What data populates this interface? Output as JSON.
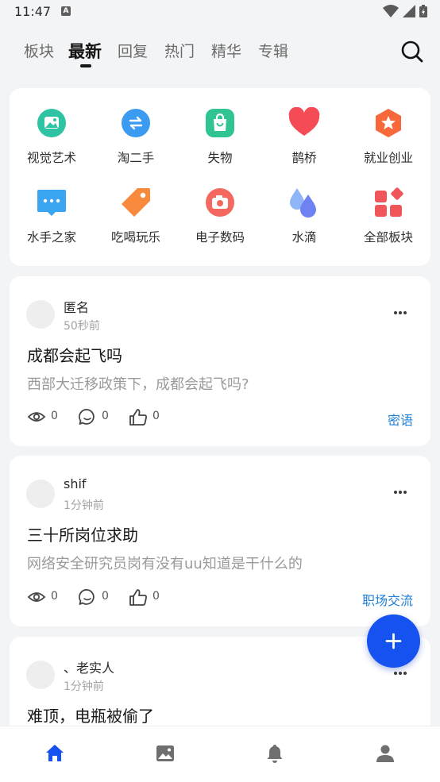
{
  "status_bar": {
    "time": "11:47",
    "indicator": "A"
  },
  "top_tabs": [
    {
      "label": "板块",
      "active": false
    },
    {
      "label": "最新",
      "active": true
    },
    {
      "label": "回复",
      "active": false
    },
    {
      "label": "热门",
      "active": false
    },
    {
      "label": "精华",
      "active": false
    },
    {
      "label": "专辑",
      "active": false
    }
  ],
  "categories": [
    {
      "label": "视觉艺术",
      "icon": "image-icon",
      "color": "#2ec4a3"
    },
    {
      "label": "淘二手",
      "icon": "exchange-icon",
      "color": "#3b9bf0"
    },
    {
      "label": "失物",
      "icon": "shopping-bag-icon",
      "color": "#30c492"
    },
    {
      "label": "鹊桥",
      "icon": "heart-icon",
      "color": "#f44b57"
    },
    {
      "label": "就业创业",
      "icon": "star-badge-icon",
      "color": "#f7683b"
    },
    {
      "label": "水手之家",
      "icon": "chat-bubble-icon",
      "color": "#3aa5f2"
    },
    {
      "label": "吃喝玩乐",
      "icon": "tag-icon",
      "color": "#f88a3e"
    },
    {
      "label": "电子数码",
      "icon": "camera-icon",
      "color": "#f4685f"
    },
    {
      "label": "水滴",
      "icon": "water-drop-icon",
      "color": "#6e82f2"
    },
    {
      "label": "全部板块",
      "icon": "all-blocks-icon",
      "color": "#f0555a"
    }
  ],
  "posts": [
    {
      "author": "匿名",
      "time": "50秒前",
      "title": "成都会起飞吗",
      "excerpt": "西部大迁移政策下，成都会起飞吗?",
      "views": "0",
      "comments": "0",
      "likes": "0",
      "tag": "密语"
    },
    {
      "author": "shif",
      "time": "1分钟前",
      "title": "三十所岗位求助",
      "excerpt": "网络安全研究员岗有没有uu知道是干什么的",
      "views": "0",
      "comments": "0",
      "likes": "0",
      "tag": "职场交流"
    },
    {
      "author": "、老实人",
      "time": "1分钟前",
      "title": "难顶，电瓶被偷了"
    }
  ],
  "bottom_nav": [
    {
      "icon": "home-icon",
      "active": true
    },
    {
      "icon": "gallery-icon",
      "active": false
    },
    {
      "icon": "bell-icon",
      "active": false
    },
    {
      "icon": "profile-icon",
      "active": false
    }
  ],
  "colors": {
    "accent": "#1552f0",
    "tag": "#1e7fd6",
    "nav_active": "#1552f0",
    "nav_inactive": "#6f6f6f"
  }
}
